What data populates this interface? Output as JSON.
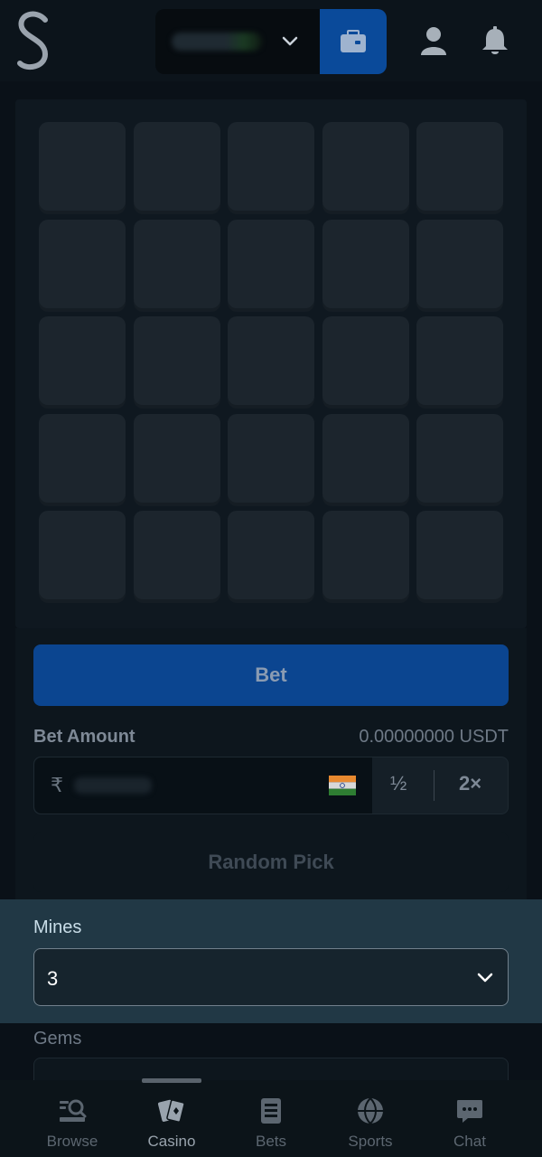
{
  "header": {
    "logo_letter": "S",
    "balance_hidden": true,
    "wallet_icon": "wallet-icon",
    "user_icon": "user-icon",
    "bell_icon": "bell-icon"
  },
  "game": {
    "grid_rows": 5,
    "grid_cols": 5,
    "tile_count": 25
  },
  "controls": {
    "bet_label": "Bet",
    "bet_amount_label": "Bet Amount",
    "bet_amount_usdt": "0.00000000 USDT",
    "currency_symbol": "₹",
    "half_label": "½",
    "double_label": "2×",
    "random_pick_label": "Random Pick",
    "mines_label": "Mines",
    "mines_value": "3",
    "gems_label": "Gems"
  },
  "nav": {
    "items": [
      {
        "label": "Browse",
        "icon": "browse-icon"
      },
      {
        "label": "Casino",
        "icon": "casino-icon",
        "active": true
      },
      {
        "label": "Bets",
        "icon": "bets-icon"
      },
      {
        "label": "Sports",
        "icon": "sports-icon"
      },
      {
        "label": "Chat",
        "icon": "chat-icon"
      }
    ]
  },
  "colors": {
    "primary_blue": "#0b4590",
    "background": "#0a1118",
    "tile": "#1c252d",
    "highlight_section": "#213845"
  }
}
